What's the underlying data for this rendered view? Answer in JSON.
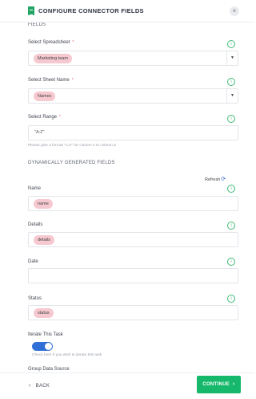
{
  "header": {
    "title": "CONFIGURE CONNECTOR FIELDS",
    "close_glyph": "×"
  },
  "sections": {
    "fields_title": "FIELDS",
    "dynamic_title": "DYNAMICALLY GENERATED FIELDS"
  },
  "spreadsheet": {
    "label": "Select Spreadsheet",
    "required": "*",
    "value": "Marketing team"
  },
  "sheet_name": {
    "label": "Select Sheet Name",
    "required": "*",
    "value": "Names"
  },
  "range": {
    "label": "Select Range",
    "required": "*",
    "value": "\"A:Z\"",
    "hint": "Please give a format \"A:Z\" for column A to column Z"
  },
  "refresh_label": "Refresh",
  "dynamic_fields": [
    {
      "label": "Name",
      "value": "name"
    },
    {
      "label": "Details",
      "value": "details"
    },
    {
      "label": "Date",
      "value": ""
    },
    {
      "label": "Status",
      "value": "status"
    }
  ],
  "iterate": {
    "label": "Iterate This Task",
    "hint": "Check here if you wish to iterate this task",
    "enabled": true
  },
  "group_data_source_label": "Group Data Source",
  "footer": {
    "back_label": "BACK",
    "continue_label": "CONTINUE"
  },
  "colors": {
    "accent_green": "#16b96b",
    "pill_pink": "#f6c9d0",
    "toggle_blue": "#2f6fd6"
  },
  "icons": {
    "info": "info-circle-icon",
    "dropdown": "caret-down-icon",
    "refresh": "refresh-icon",
    "sheet": "google-sheets-icon"
  }
}
